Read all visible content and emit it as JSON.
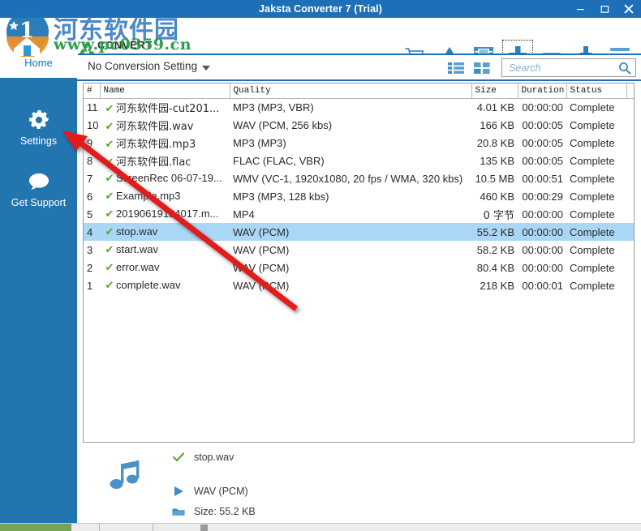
{
  "window": {
    "title": "Jaksta Converter 7 (Trial)",
    "controls": [
      {
        "name": "minimize",
        "glyph": "minimize-icon"
      },
      {
        "name": "maximize",
        "glyph": "maximize-icon"
      },
      {
        "name": "close",
        "glyph": "close-icon"
      }
    ],
    "titlebar_color": "#1d70b7"
  },
  "brand": {
    "text": "CONVERT",
    "icon": "recycle-icon"
  },
  "toolbar": {
    "buttons": [
      {
        "name": "cart-icon",
        "title": "Buy"
      },
      {
        "name": "flame-icon",
        "title": "Burn"
      },
      {
        "name": "film-icon",
        "title": "Video"
      },
      {
        "name": "plus-icon",
        "title": "Add",
        "focused": true
      },
      {
        "name": "minus-icon",
        "title": "Remove"
      },
      {
        "name": "download-icon",
        "title": "Save"
      },
      {
        "name": "hamburger-menu-icon",
        "title": "Menu"
      }
    ]
  },
  "sidebar": {
    "home_label": "Home",
    "items": [
      {
        "label": "Settings",
        "icon": "gear-icon"
      },
      {
        "label": "Get Support",
        "icon": "speech-bubble-icon"
      }
    ],
    "accent_color": "#2375b0"
  },
  "conversion_bar": {
    "setting_label": "No Conversion Setting",
    "caret": "chevron-down-icon",
    "view_list_icon": "list-view-icon",
    "view_grid_icon": "grid-view-icon"
  },
  "search": {
    "value": "",
    "placeholder": "Search",
    "icon": "search-icon"
  },
  "filelist": {
    "columns": [
      "#",
      "Name",
      "Quality",
      "Size",
      "Duration",
      "Status"
    ],
    "selected_index": 7,
    "selection_color": "#aad7f5",
    "rows": [
      {
        "num": "11",
        "name": "河东软件园-cut201...",
        "quality": "MP3 (MP3, VBR)",
        "size": "4.01 KB",
        "duration": "00:00:00",
        "status": "Complete"
      },
      {
        "num": "10",
        "name": "河东软件园.wav",
        "quality": "WAV (PCM, 256 kbs)",
        "size": "166 KB",
        "duration": "00:00:05",
        "status": "Complete"
      },
      {
        "num": "9",
        "name": "河东软件园.mp3",
        "quality": "MP3 (MP3)",
        "size": "20.8 KB",
        "duration": "00:00:05",
        "status": "Complete"
      },
      {
        "num": "8",
        "name": "河东软件园.flac",
        "quality": "FLAC (FLAC, VBR)",
        "size": "135 KB",
        "duration": "00:00:05",
        "status": "Complete"
      },
      {
        "num": "7",
        "name": "ScreenRec 06-07-19...",
        "quality": "WMV (VC-1, 1920x1080, 20 fps / WMA, 320 kbs)",
        "size": "10.5 MB",
        "duration": "00:00:51",
        "status": "Complete"
      },
      {
        "num": "6",
        "name": "Example.mp3",
        "quality": "MP3 (MP3, 128 kbs)",
        "size": "460 KB",
        "duration": "00:00:29",
        "status": "Complete"
      },
      {
        "num": "5",
        "name": "20190619134017.m...",
        "quality": "MP4",
        "size": "0 字节",
        "duration": "00:00:00",
        "status": "Complete"
      },
      {
        "num": "4",
        "name": "stop.wav",
        "quality": "WAV (PCM)",
        "size": "55.2 KB",
        "duration": "00:00:00",
        "status": "Complete"
      },
      {
        "num": "3",
        "name": "start.wav",
        "quality": "WAV (PCM)",
        "size": "58.2 KB",
        "duration": "00:00:00",
        "status": "Complete"
      },
      {
        "num": "2",
        "name": "error.wav",
        "quality": "WAV (PCM)",
        "size": "80.4 KB",
        "duration": "00:00:00",
        "status": "Complete"
      },
      {
        "num": "1",
        "name": "complete.wav",
        "quality": "WAV (PCM)",
        "size": "218 KB",
        "duration": "00:00:01",
        "status": "Complete"
      }
    ]
  },
  "detail": {
    "thumb_icon": "music-note-icon",
    "filename": "stop.wav",
    "filename_icon": "check-icon",
    "format": "WAV (PCM)",
    "format_icon": "play-icon",
    "size": "Size:  55.2 KB",
    "size_icon": "folder-icon"
  },
  "watermark": {
    "chinese": "河东软件园",
    "url": "www.pc0359.cn"
  },
  "annotation": {
    "arrow_color": "#e01b1b",
    "points_to": "Settings"
  }
}
